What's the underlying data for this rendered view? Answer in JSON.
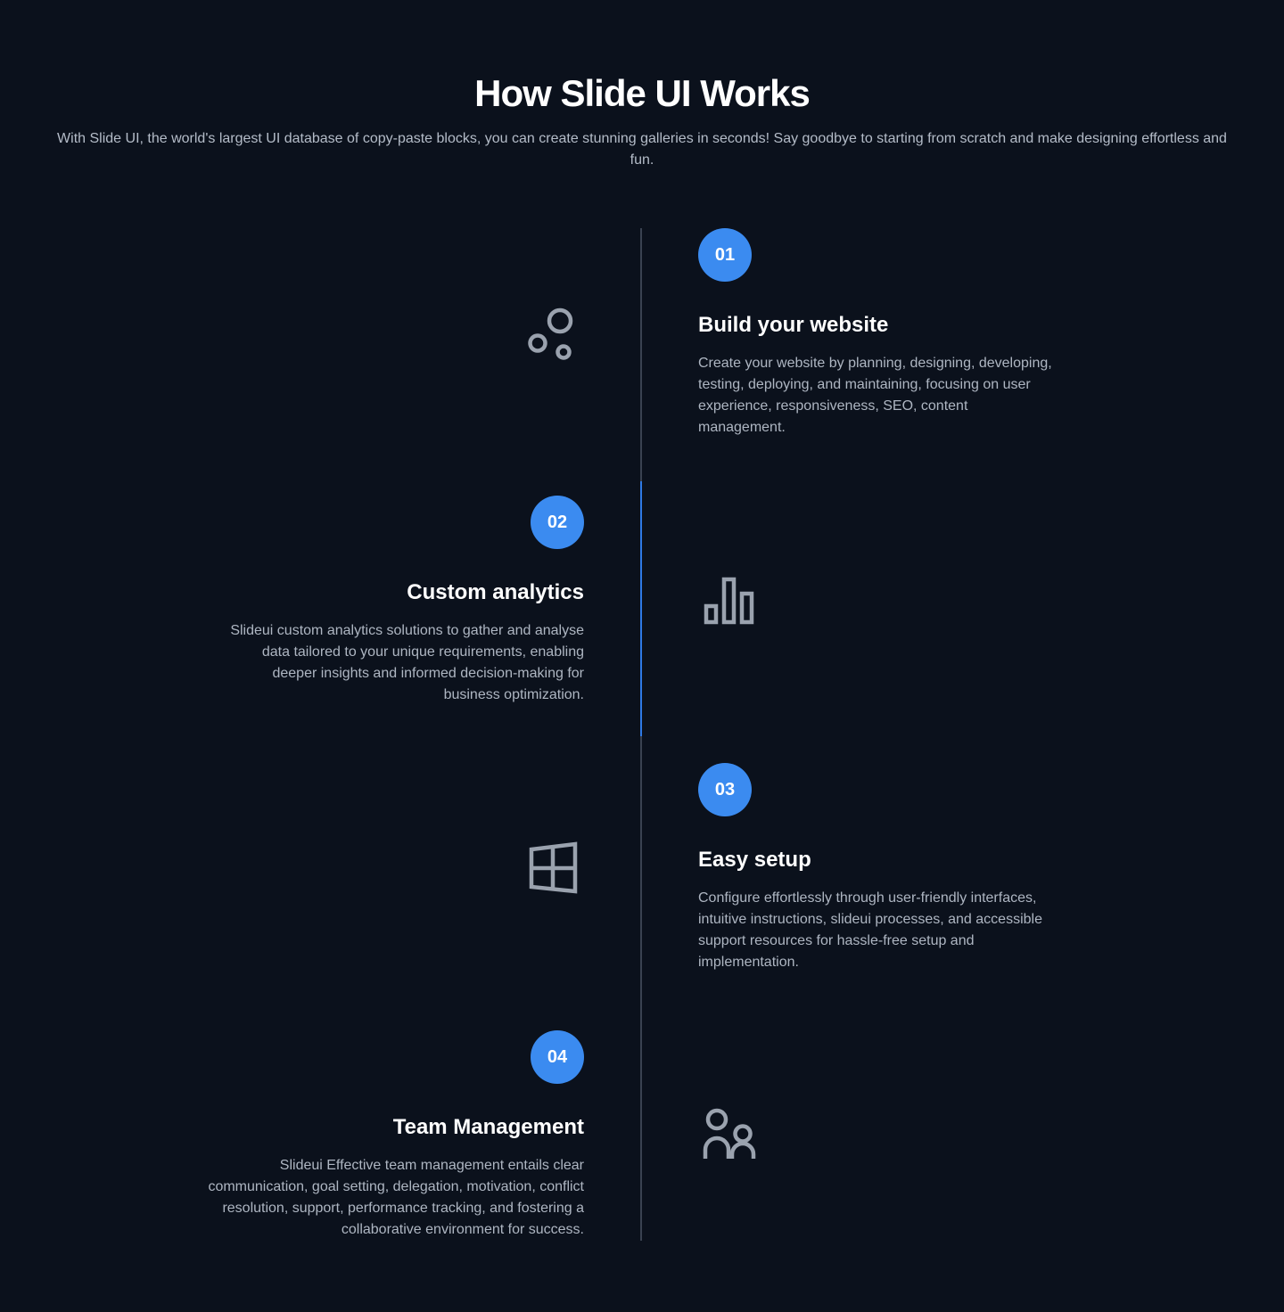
{
  "header": {
    "title": "How Slide UI Works",
    "subtitle": "With Slide UI, the world's largest UI database of copy-paste blocks, you can create stunning galleries in seconds! Say goodbye to starting from scratch and make designing effortless and fun."
  },
  "colors": {
    "background": "#0b111c",
    "accent": "#3b8bf0",
    "line": "#3a4251",
    "icon": "#9aa2ae"
  },
  "steps": [
    {
      "number": "01",
      "title": "Build your website",
      "description": "Create your website by planning, designing, developing, testing, deploying, and maintaining, focusing on user experience, responsiveness, SEO, content management.",
      "icon": "bubbles-icon"
    },
    {
      "number": "02",
      "title": "Custom analytics",
      "description": "Slideui custom analytics solutions to gather and analyse data tailored to your unique requirements, enabling deeper insights and informed decision-making for business optimization.",
      "icon": "bar-chart-icon"
    },
    {
      "number": "03",
      "title": "Easy setup",
      "description": "Configure effortlessly through user-friendly interfaces, intuitive instructions, slideui processes, and accessible support resources for hassle-free setup and implementation.",
      "icon": "windows-icon"
    },
    {
      "number": "04",
      "title": "Team Management",
      "description": "Slideui Effective team management entails clear communication, goal setting, delegation, motivation, conflict resolution, support, performance tracking, and fostering a collaborative environment for success.",
      "icon": "team-icon"
    }
  ]
}
